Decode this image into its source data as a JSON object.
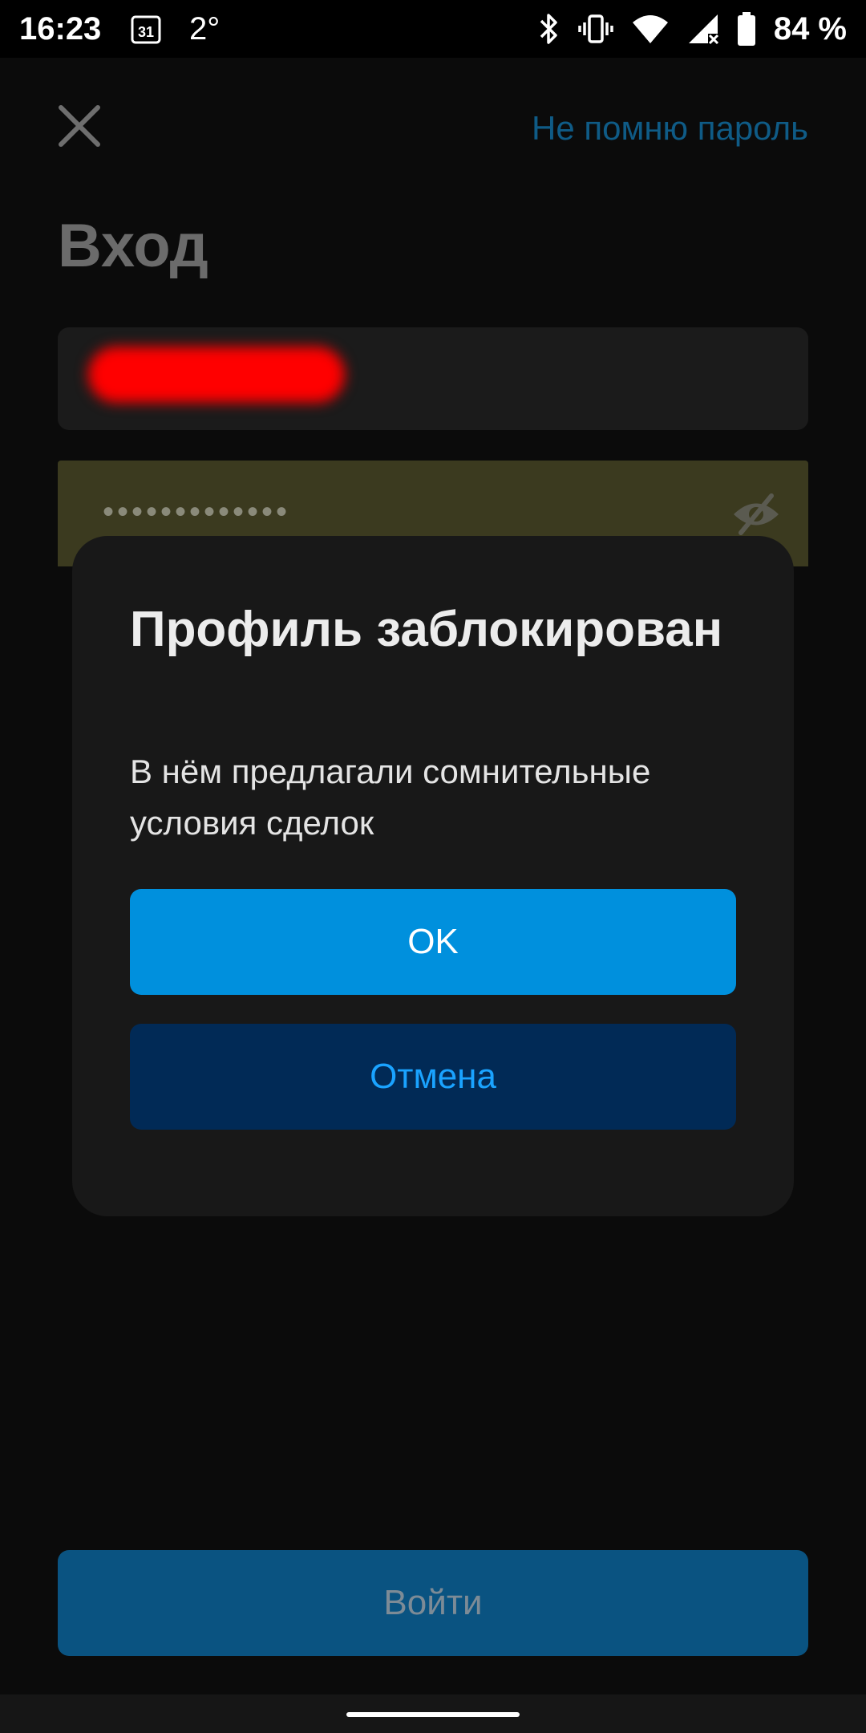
{
  "status_bar": {
    "time": "16:23",
    "calendar_day": "31",
    "temperature": "2°",
    "battery_percent": "84 %",
    "icons": [
      "bluetooth-icon",
      "vibrate-icon",
      "wifi-icon",
      "cell-signal-icon",
      "battery-icon"
    ]
  },
  "header": {
    "close_icon": "close-icon",
    "forgot_password_label": "Не помню пароль"
  },
  "page": {
    "title": "Вход"
  },
  "form": {
    "password_mask": "•••••••••••••",
    "toggle_visibility_icon": "eye-off-icon",
    "submit_label": "Войти"
  },
  "dialog": {
    "title": "Профиль заблокирован",
    "message": "В нём предлагали сомнительные условия сделок",
    "ok_label": "OK",
    "cancel_label": "Отмена"
  },
  "colors": {
    "accent": "#0090dd",
    "cancel_bg": "#012a56",
    "cancel_text": "#1aa3ff",
    "link": "#0f5b86"
  }
}
